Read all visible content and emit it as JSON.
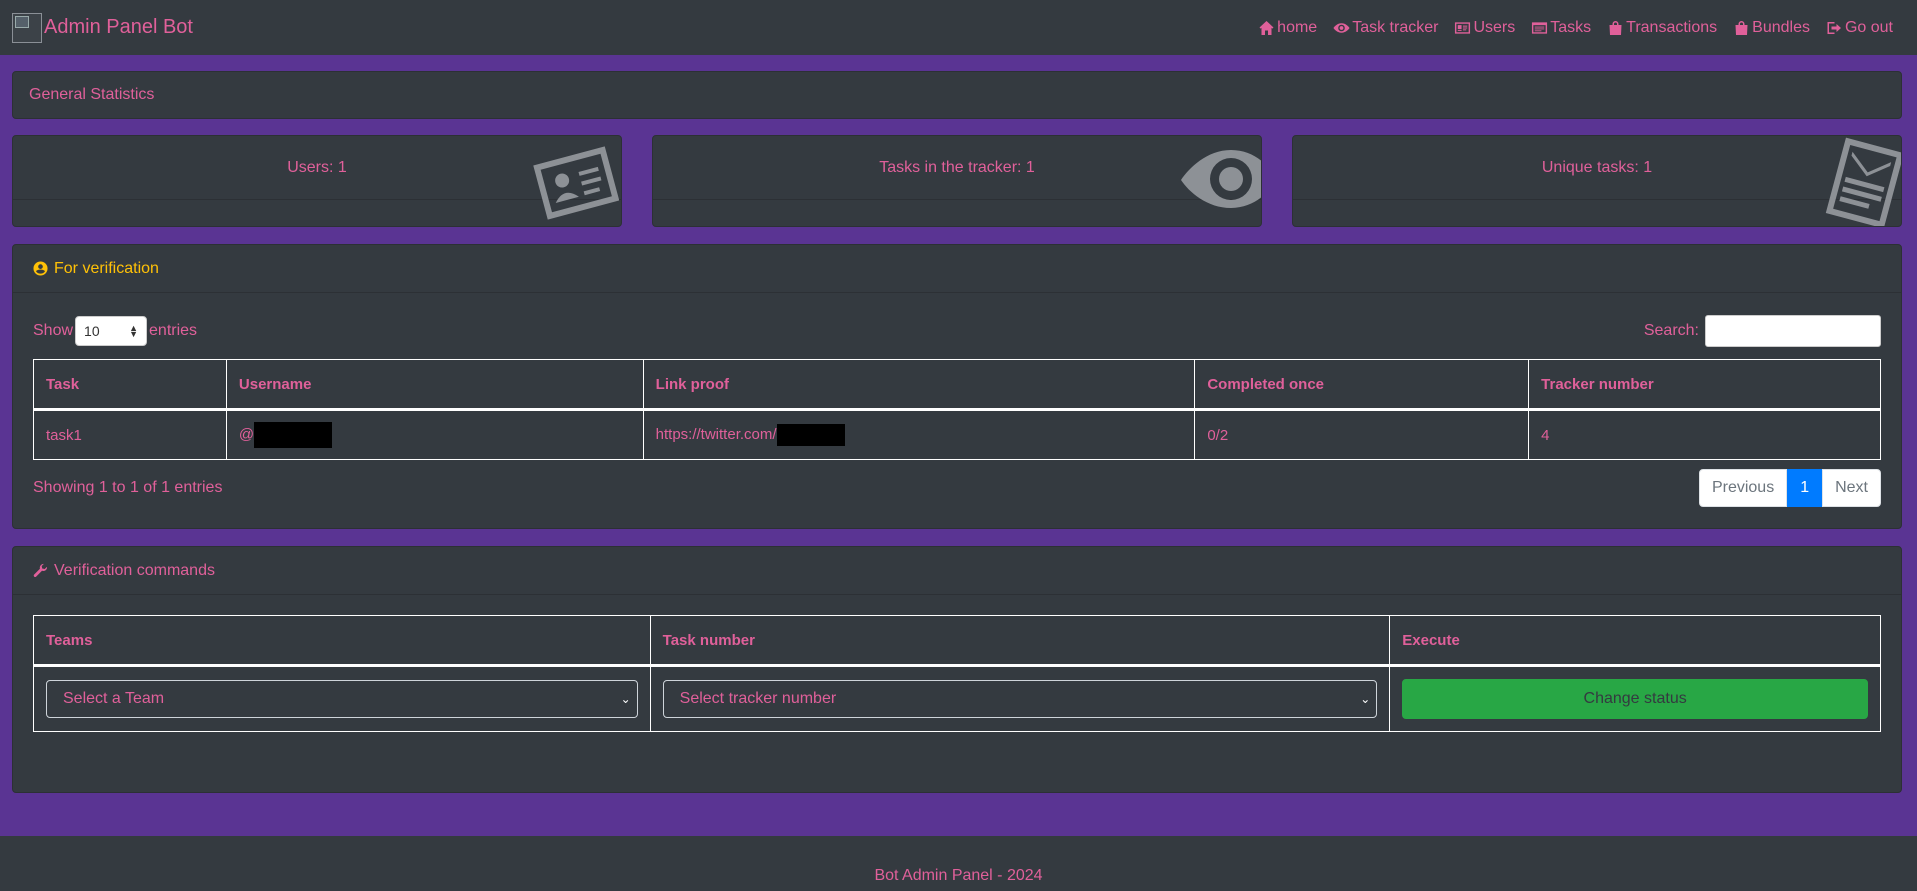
{
  "navbar": {
    "brand": "Admin Panel Bot",
    "items": [
      {
        "label": "home",
        "icon": "home-icon"
      },
      {
        "label": "Task tracker",
        "icon": "eye-icon"
      },
      {
        "label": "Users",
        "icon": "id-card-icon"
      },
      {
        "label": "Tasks",
        "icon": "list-icon"
      },
      {
        "label": "Transactions",
        "icon": "bag-icon"
      },
      {
        "label": "Bundles",
        "icon": "bag-icon"
      },
      {
        "label": "Go out",
        "icon": "sign-out-icon"
      }
    ]
  },
  "general": {
    "title": "General Statistics"
  },
  "stats": [
    {
      "label": "Users: 1",
      "icon": "id-card-icon"
    },
    {
      "label": "Tasks in the tracker: 1",
      "icon": "eye-icon"
    },
    {
      "label": "Unique tasks: 1",
      "icon": "newspaper-icon"
    }
  ],
  "verification": {
    "title": "For verification",
    "show_label": "Show",
    "entries_label": "entries",
    "page_size": "10",
    "search_label": "Search:",
    "search_value": "",
    "columns": [
      "Task",
      "Username",
      "Link proof",
      "Completed once",
      "Tracker number"
    ],
    "rows": [
      {
        "task": "task1",
        "username_prefix": "@",
        "link_prefix": "https://twitter.com/",
        "completed": "0/2",
        "tracker": "4"
      }
    ],
    "info": "Showing 1 to 1 of 1 entries",
    "pagination": {
      "previous": "Previous",
      "current": "1",
      "next": "Next"
    }
  },
  "commands": {
    "title": "Verification commands",
    "columns": [
      "Teams",
      "Task number",
      "Execute"
    ],
    "team_select": "Select a Team",
    "tracker_select": "Select tracker number",
    "execute_label": "Change status"
  },
  "footer": {
    "text": "Bot Admin Panel - 2024"
  },
  "colors": {
    "background": "#5a3493",
    "panel": "#343a40",
    "text": "#e0609a",
    "header_accent": "#ffc107",
    "execute_button": "#28a745",
    "pager_active": "#007bff"
  }
}
